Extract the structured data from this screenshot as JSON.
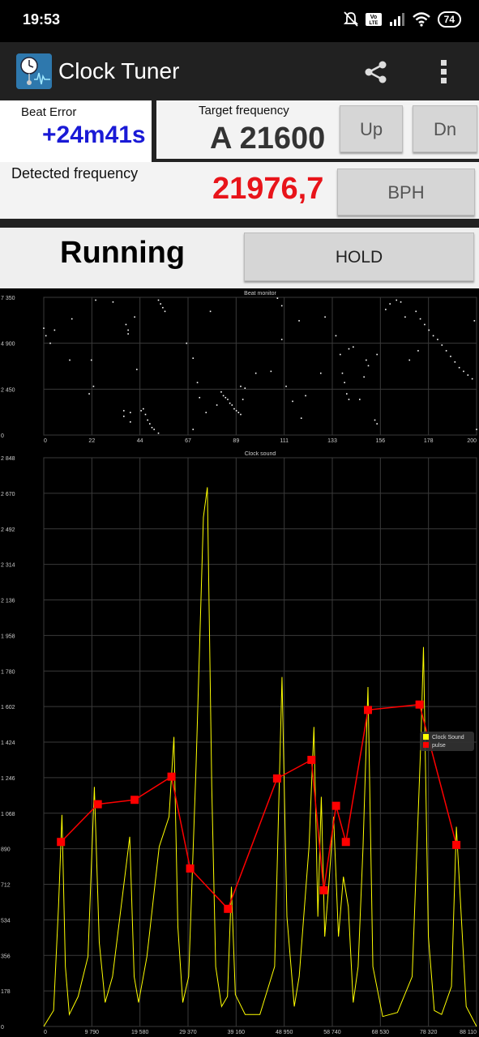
{
  "status_bar": {
    "time": "19:53",
    "battery": "74"
  },
  "app_bar": {
    "title": "Clock Tuner",
    "icons": [
      "app-logo-icon",
      "share-icon",
      "overflow-menu-icon"
    ]
  },
  "beat_error": {
    "label": "Beat Error",
    "value": "+24m41s",
    "color": "#1a1ad6"
  },
  "target": {
    "label": "Target frequency",
    "value": "A 21600",
    "up_label": "Up",
    "dn_label": "Dn"
  },
  "detected": {
    "label": "Detected frequency",
    "value": "21976,7",
    "color": "#e8141a",
    "unit_button": "BPH"
  },
  "status": {
    "text": "Running",
    "hold_label": "HOLD"
  },
  "chart_data": [
    {
      "type": "scatter",
      "title": "Beat monitor",
      "x_ticks": [
        "0",
        "22",
        "44",
        "67",
        "89",
        "111",
        "133",
        "156",
        "178",
        "200"
      ],
      "y_ticks": [
        "7 350",
        "4 900",
        "2 450",
        "0"
      ],
      "xlim": [
        0,
        200
      ],
      "ylim": [
        0,
        7350
      ],
      "grid": true,
      "color": "#ffffff",
      "points": [
        [
          0,
          5700
        ],
        [
          1,
          5300
        ],
        [
          3,
          4900
        ],
        [
          5,
          5600
        ],
        [
          12,
          4000
        ],
        [
          13,
          6200
        ],
        [
          21,
          2200
        ],
        [
          22,
          4000
        ],
        [
          23,
          2600
        ],
        [
          24,
          7200
        ],
        [
          32,
          7100
        ],
        [
          37,
          1000
        ],
        [
          37,
          1300
        ],
        [
          38,
          5900
        ],
        [
          39,
          5600
        ],
        [
          39,
          5400
        ],
        [
          40,
          1200
        ],
        [
          40,
          700
        ],
        [
          42,
          6300
        ],
        [
          43,
          3500
        ],
        [
          45,
          1300
        ],
        [
          46,
          1400
        ],
        [
          47,
          1100
        ],
        [
          48,
          800
        ],
        [
          49,
          600
        ],
        [
          50,
          400
        ],
        [
          51,
          300
        ],
        [
          53,
          100
        ],
        [
          53,
          7200
        ],
        [
          54,
          7000
        ],
        [
          55,
          6800
        ],
        [
          56,
          6600
        ],
        [
          66,
          4900
        ],
        [
          69,
          300
        ],
        [
          69,
          4100
        ],
        [
          71,
          2800
        ],
        [
          72,
          2000
        ],
        [
          75,
          1200
        ],
        [
          77,
          6600
        ],
        [
          80,
          1600
        ],
        [
          82,
          2300
        ],
        [
          83,
          2100
        ],
        [
          84,
          2000
        ],
        [
          85,
          1900
        ],
        [
          86,
          1700
        ],
        [
          87,
          1600
        ],
        [
          88,
          1400
        ],
        [
          89,
          1300
        ],
        [
          90,
          1200
        ],
        [
          91,
          1100
        ],
        [
          91,
          2600
        ],
        [
          92,
          1900
        ],
        [
          93,
          2500
        ],
        [
          98,
          3300
        ],
        [
          105,
          3400
        ],
        [
          108,
          7300
        ],
        [
          110,
          5100
        ],
        [
          110,
          6900
        ],
        [
          112,
          2600
        ],
        [
          115,
          1800
        ],
        [
          118,
          6100
        ],
        [
          119,
          900
        ],
        [
          121,
          2100
        ],
        [
          128,
          3300
        ],
        [
          130,
          6300
        ],
        [
          135,
          5300
        ],
        [
          137,
          4300
        ],
        [
          138,
          3300
        ],
        [
          139,
          2800
        ],
        [
          140,
          2200
        ],
        [
          141,
          1900
        ],
        [
          141,
          4600
        ],
        [
          143,
          4700
        ],
        [
          146,
          1900
        ],
        [
          148,
          3100
        ],
        [
          149,
          4000
        ],
        [
          150,
          3700
        ],
        [
          153,
          800
        ],
        [
          154,
          600
        ],
        [
          154,
          4300
        ],
        [
          158,
          6700
        ],
        [
          160,
          7000
        ],
        [
          163,
          7200
        ],
        [
          165,
          7100
        ],
        [
          167,
          6300
        ],
        [
          169,
          4000
        ],
        [
          172,
          6600
        ],
        [
          173,
          4500
        ],
        [
          174,
          6200
        ],
        [
          176,
          5900
        ],
        [
          178,
          5600
        ],
        [
          180,
          5300
        ],
        [
          182,
          5100
        ],
        [
          184,
          4800
        ],
        [
          186,
          4500
        ],
        [
          188,
          4200
        ],
        [
          190,
          3900
        ],
        [
          192,
          3600
        ],
        [
          194,
          3400
        ],
        [
          196,
          3200
        ],
        [
          198,
          3000
        ],
        [
          199,
          6100
        ],
        [
          200,
          300
        ]
      ]
    },
    {
      "type": "line",
      "title": "Clock sound",
      "x_ticks": [
        "0",
        "9 790",
        "19 580",
        "29 370",
        "39 160",
        "48 950",
        "58 740",
        "68 530",
        "78 320",
        "88 110"
      ],
      "y_ticks": [
        "2 848",
        "2 670",
        "2 492",
        "2 314",
        "2 136",
        "1 958",
        "1 780",
        "1 602",
        "1 424",
        "1 246",
        "1 068",
        "890",
        "712",
        "534",
        "356",
        "178",
        "0"
      ],
      "xlim": [
        0,
        88110
      ],
      "ylim": [
        0,
        2848
      ],
      "grid": true,
      "legend": {
        "placement": "right",
        "entries": [
          {
            "name": "Clock Sound",
            "color": "#ffff00"
          },
          {
            "name": "pulse",
            "color": "#ff0000"
          }
        ]
      },
      "series": [
        {
          "name": "pulse",
          "color": "#ff0000",
          "points": [
            [
              3500,
              924
            ],
            [
              11000,
              1113
            ],
            [
              18500,
              1135
            ],
            [
              26000,
              1251
            ],
            [
              29800,
              791
            ],
            [
              37500,
              589
            ],
            [
              47500,
              1242
            ],
            [
              54500,
              1335
            ],
            [
              57000,
              682
            ],
            [
              59500,
              1105
            ],
            [
              61500,
              924
            ],
            [
              66000,
              1585
            ],
            [
              76500,
              1612
            ],
            [
              84000,
              909
            ]
          ]
        },
        {
          "name": "Clock Sound",
          "color": "#ffff00",
          "points": [
            [
              0,
              0
            ],
            [
              2000,
              80
            ],
            [
              3000,
              600
            ],
            [
              3700,
              1060
            ],
            [
              4400,
              300
            ],
            [
              5200,
              60
            ],
            [
              7000,
              150
            ],
            [
              9000,
              350
            ],
            [
              10300,
              1200
            ],
            [
              11300,
              420
            ],
            [
              12500,
              120
            ],
            [
              14000,
              250
            ],
            [
              16000,
              650
            ],
            [
              17500,
              950
            ],
            [
              18400,
              250
            ],
            [
              19300,
              120
            ],
            [
              21000,
              350
            ],
            [
              23500,
              900
            ],
            [
              25500,
              1050
            ],
            [
              26500,
              1450
            ],
            [
              27300,
              500
            ],
            [
              28300,
              120
            ],
            [
              29500,
              250
            ],
            [
              31000,
              1300
            ],
            [
              32500,
              2550
            ],
            [
              33300,
              2700
            ],
            [
              34200,
              1200
            ],
            [
              35000,
              300
            ],
            [
              36200,
              100
            ],
            [
              37400,
              150
            ],
            [
              38200,
              700
            ],
            [
              39000,
              160
            ],
            [
              41000,
              60
            ],
            [
              44000,
              60
            ],
            [
              47000,
              300
            ],
            [
              48500,
              1750
            ],
            [
              49500,
              550
            ],
            [
              51000,
              100
            ],
            [
              52000,
              250
            ],
            [
              54000,
              900
            ],
            [
              55000,
              1500
            ],
            [
              55800,
              550
            ],
            [
              56500,
              1150
            ],
            [
              57200,
              450
            ],
            [
              58000,
              700
            ],
            [
              59000,
              1050
            ],
            [
              60000,
              450
            ],
            [
              61000,
              750
            ],
            [
              62000,
              600
            ],
            [
              63000,
              120
            ],
            [
              64000,
              300
            ],
            [
              65000,
              900
            ],
            [
              66000,
              1700
            ],
            [
              67000,
              300
            ],
            [
              69000,
              50
            ],
            [
              72000,
              70
            ],
            [
              75000,
              250
            ],
            [
              76800,
              1450
            ],
            [
              77300,
              1900
            ],
            [
              78300,
              450
            ],
            [
              79500,
              80
            ],
            [
              81000,
              60
            ],
            [
              83000,
              200
            ],
            [
              84000,
              1000
            ],
            [
              85000,
              550
            ],
            [
              86000,
              100
            ],
            [
              88110,
              0
            ]
          ]
        }
      ]
    }
  ]
}
